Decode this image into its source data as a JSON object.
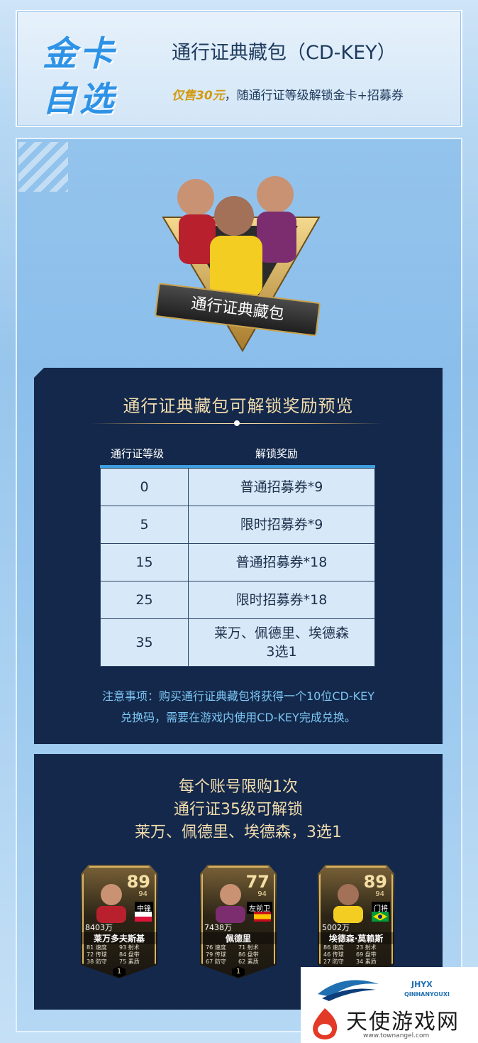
{
  "banner": {
    "big_line1": "金卡",
    "big_line2": "自选",
    "title": "通行证典藏包（CD-KEY）",
    "price": "仅售30元",
    "sub_rest": "，随通行证等级解锁金卡+招募券"
  },
  "hero": {
    "label": "通行证典藏包"
  },
  "rewards": {
    "title": "通行证典藏包可解锁奖励预览",
    "col_level": "通行证等级",
    "col_reward": "解锁奖励",
    "rows": [
      {
        "level": "0",
        "reward": "普通招募券*9"
      },
      {
        "level": "5",
        "reward": "限时招募券*9"
      },
      {
        "level": "15",
        "reward": "普通招募券*18"
      },
      {
        "level": "25",
        "reward": "限时招募券*18"
      },
      {
        "level": "35",
        "reward": "莱万、佩德里、埃德森",
        "reward2": "3选1"
      }
    ],
    "note_line1": "注意事项：购买通行证典藏包将获得一个10位CD-KEY",
    "note_line2": "兑换码，需要在游戏内使用CD-KEY完成兑换。"
  },
  "limit": {
    "line1": "每个账号限购1次",
    "line2": "通行证35级可解锁",
    "line3": "莱万、佩德里、埃德森，3选1"
  },
  "cards": [
    {
      "rating": "89",
      "sub": "94",
      "position": "中锋",
      "price": "8403万",
      "name": "莱万多夫斯基",
      "stats": [
        "81 速度",
        "93 射术",
        "72 传球",
        "84 盘带",
        "38 防守",
        "75 素质"
      ],
      "badge": "1"
    },
    {
      "rating": "77",
      "sub": "94",
      "position": "左前卫",
      "price": "7438万",
      "name": "佩德里",
      "stats": [
        "76 速度",
        "71 射术",
        "79 传球",
        "86 盘带",
        "67 防守",
        "62 素质"
      ],
      "badge": "1"
    },
    {
      "rating": "89",
      "sub": "94",
      "position": "门将",
      "price": "5002万",
      "name": "埃德森·莫赖斯",
      "stats": [
        "86 速度",
        "23 射术",
        "46 传球",
        "69 盘带",
        "27 防守",
        "34 素质"
      ],
      "badge": "1"
    }
  ],
  "watermark": {
    "brand": "JHYX",
    "brand_pinyin": "QINHANYOUXI",
    "site_name": "天使游戏网",
    "url": "www.townangel.com"
  },
  "colors": {
    "accent_blue": "#2e93e6",
    "gold": "#d39a12",
    "navy": "#13284a"
  }
}
